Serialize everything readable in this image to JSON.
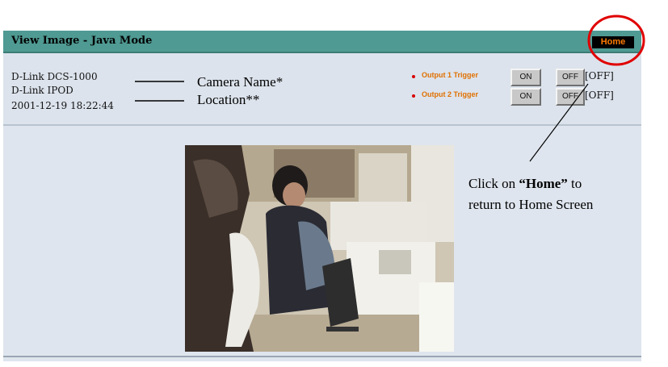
{
  "header": {
    "title": "View Image - Java Mode",
    "home_label": "Home"
  },
  "camera": {
    "name": "D-Link DCS-1000",
    "location": "D-Link IPOD",
    "datetime": "2001-12-19 18:22:44"
  },
  "outputs": [
    {
      "label": "Output 1 Trigger",
      "on_label": "ON",
      "off_label": "OFF",
      "state": "[OFF]"
    },
    {
      "label": "Output 2 Trigger",
      "on_label": "ON",
      "off_label": "OFF",
      "state": "[OFF]"
    }
  ],
  "annotations": {
    "camera_name": "Camera Name*",
    "location": "Location**",
    "click_prefix": "Click on ",
    "click_home": "“Home”",
    "click_suffix": " to",
    "click_line2": "return to Home Screen"
  },
  "colors": {
    "title_bar": "#4f9a93",
    "panel": "#dce3ec",
    "home_text": "#ff7a00",
    "trigger_text": "#e07000",
    "highlight_circle": "#e00000"
  }
}
